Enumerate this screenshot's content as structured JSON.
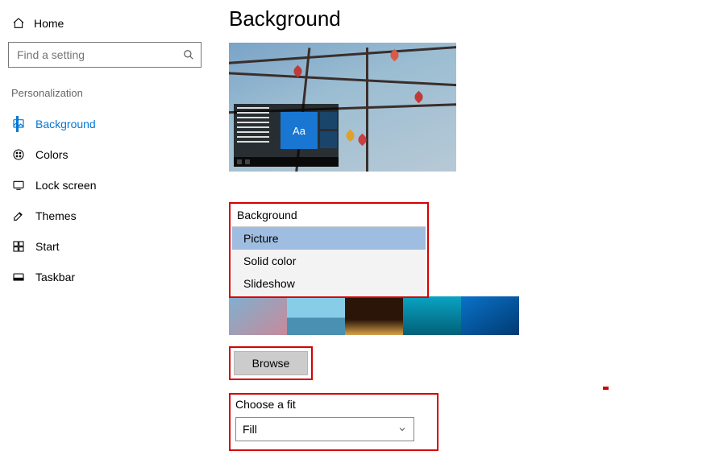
{
  "sidebar": {
    "home_label": "Home",
    "search_placeholder": "Find a setting",
    "section_header": "Personalization",
    "items": [
      {
        "label": "Background"
      },
      {
        "label": "Colors"
      },
      {
        "label": "Lock screen"
      },
      {
        "label": "Themes"
      },
      {
        "label": "Start"
      },
      {
        "label": "Taskbar"
      }
    ]
  },
  "main": {
    "page_title": "Background",
    "preview_tile_text": "Aa",
    "background_section_label": "Background",
    "background_options": {
      "selected": "Picture",
      "opt0": "Picture",
      "opt1": "Solid color",
      "opt2": "Slideshow"
    },
    "browse_label": "Browse",
    "fit_label": "Choose a fit",
    "fit_value": "Fill"
  }
}
